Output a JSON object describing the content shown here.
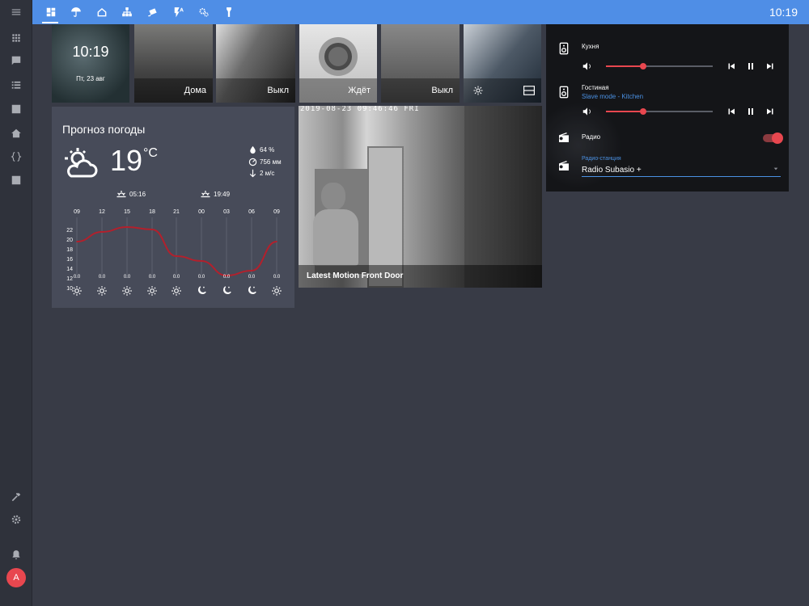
{
  "topbar": {
    "time": "10:19",
    "tabs": [
      "dashboard-icon",
      "umbrella-icon",
      "home-icon",
      "network-icon",
      "cctv-icon",
      "flash-auto-icon",
      "cogs-icon",
      "flashlight-icon"
    ]
  },
  "sidebar": {
    "items": [
      "menu-icon",
      "apps-icon",
      "message-icon",
      "list-icon",
      "chart-icon",
      "home-account-icon",
      "code-braces-icon",
      "text-box-icon"
    ],
    "bottom": [
      "hammer-icon",
      "settings-icon",
      "bell-icon"
    ],
    "avatar_initial": "A"
  },
  "tiles": {
    "clock": {
      "time": "10:19",
      "date": "Пт, 23 авг"
    },
    "face": {
      "label": "Дома"
    },
    "people": {
      "label": "Выкл"
    },
    "washer": {
      "label": "Ждёт"
    },
    "laundry": {
      "label": "Выкл"
    }
  },
  "weather": {
    "title": "Прогноз погоды",
    "temperature": "19",
    "unit": "°C",
    "humidity": "64 %",
    "pressure": "756 мм",
    "wind": "2 м/с",
    "sunrise": "05:16",
    "sunset": "19:49",
    "hours": [
      "09",
      "12",
      "15",
      "18",
      "21",
      "00",
      "03",
      "06",
      "09"
    ],
    "y_ticks": [
      "22",
      "20",
      "18",
      "16",
      "14",
      "12",
      "10"
    ],
    "temps": [
      18,
      20,
      21,
      20.5,
      15,
      14,
      11,
      12,
      18
    ],
    "precip": [
      "0.0",
      "0.0",
      "0.0",
      "0.0",
      "0.0",
      "0.0",
      "0.0",
      "0.0",
      "0.0"
    ],
    "conditions": [
      "sunny",
      "sunny",
      "sunny",
      "sunny",
      "sunny",
      "night",
      "night",
      "night",
      "sunny"
    ],
    "line_color": "#b3202c"
  },
  "camera": {
    "timestamp": "2019-08-23 09:46:46 FRI",
    "label": "Latest Motion Front Door"
  },
  "media": {
    "kitchen": {
      "name": "Кухня",
      "volume": 0.35
    },
    "living": {
      "name": "Гостиная",
      "subtitle": "Slave mode - Kitchen",
      "volume": 0.35
    },
    "radio": {
      "name": "Радио",
      "on": true
    },
    "station": {
      "label": "Радио-станция",
      "value": "Radio Subasio +"
    },
    "accent": "#e8474f"
  }
}
